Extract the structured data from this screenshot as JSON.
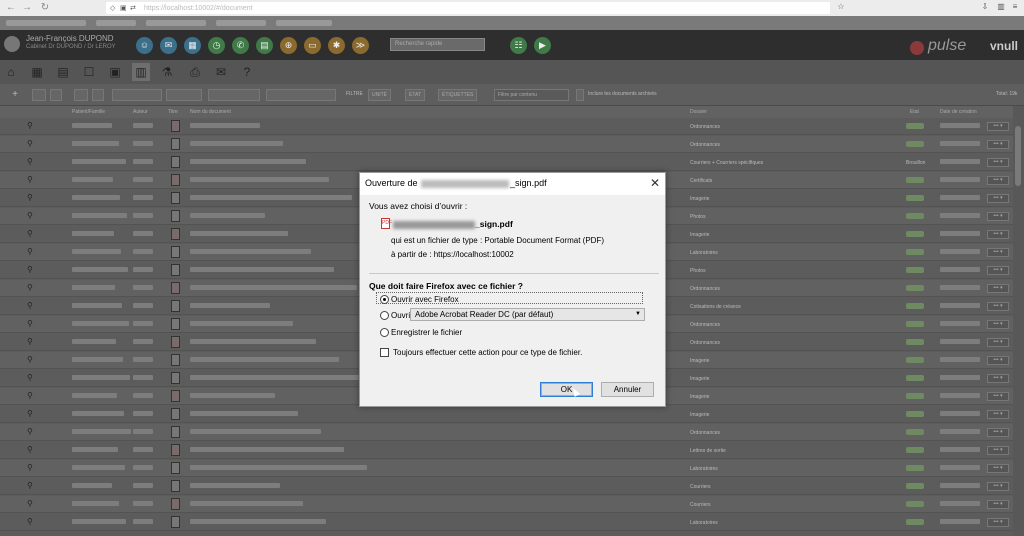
{
  "browser": {
    "url": "https://localhost:10002/#/document",
    "nav_icons": [
      "back-icon",
      "forward-icon",
      "reload-icon"
    ]
  },
  "app": {
    "user_name": "Jean-François DUPOND",
    "user_sub": "Cabinet Dr DUPOND / Dr LEROY",
    "search_placeholder": "Recherche rapide",
    "brand": "pulse",
    "brand_suffix": "vnull"
  },
  "toolbar": {
    "filter_label": "FILTRE",
    "filter_unite": "UNITÉ",
    "filter_etat": "ÉTAT",
    "filter_etiquettes": "ÉTIQUETTES",
    "filter_pattern_placeholder": "Filtre par contenu",
    "include_archived": "Inclure les documents archivés",
    "total": "Total: 19k"
  },
  "table": {
    "headers": [
      "Patient/Famille",
      "Auteur",
      "Titre",
      "Nom du document",
      "Dossier",
      "Etat",
      "Date de création"
    ],
    "rows": [
      {
        "folder": "Ordonnances"
      },
      {
        "folder": "Ordonnances"
      },
      {
        "folder": "Courriers + Courriers spécifiques",
        "state": "Brouillon"
      },
      {
        "folder": "Certificats"
      },
      {
        "folder": "Imagerie"
      },
      {
        "folder": "Photos"
      },
      {
        "folder": "Imagerie"
      },
      {
        "folder": "Laboratoires"
      },
      {
        "folder": "Photos"
      },
      {
        "folder": "Ordonnances"
      },
      {
        "folder": "Cotisations de créance"
      },
      {
        "folder": "Ordonnances"
      },
      {
        "folder": "Ordonnances"
      },
      {
        "folder": "Imagerie"
      },
      {
        "folder": "Imagerie"
      },
      {
        "folder": "Imagerie"
      },
      {
        "folder": "Imagerie"
      },
      {
        "folder": "Ordonnances"
      },
      {
        "folder": "Lettres de sortie"
      },
      {
        "folder": "Laboratoires"
      },
      {
        "folder": "Courriers"
      },
      {
        "folder": "Courriers"
      },
      {
        "folder": "Laboratoires"
      }
    ]
  },
  "dialog": {
    "title_prefix": "Ouverture de",
    "title_suffix": "_sign.pdf",
    "chosen_label": "Vous avez choisi d’ouvrir :",
    "filename": "WorkshopHandouts_sign.pdf",
    "filetype_label": "qui est un fichier de type : ",
    "filetype_value": "Portable Document Format (PDF)",
    "from_label": "à partir de : ",
    "from_value": "https://localhost:10002",
    "question": "Que doit faire Firefox avec ce fichier ?",
    "option_open_firefox": "Ouvrir avec Firefox",
    "option_open_with": "Ouvrir avec",
    "open_with_app": "Adobe Acrobat Reader DC (par défaut)",
    "option_save": "Enregistrer le fichier",
    "always_do": "Toujours effectuer cette action pour ce type de fichier.",
    "ok": "OK",
    "cancel": "Annuler",
    "selected_option": "open_firefox"
  }
}
